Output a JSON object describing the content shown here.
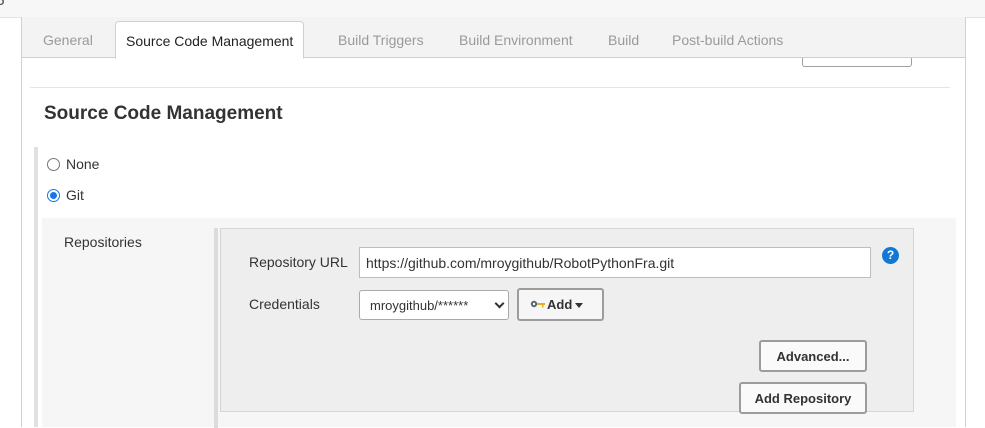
{
  "tabs": [
    {
      "label": "General",
      "active": false
    },
    {
      "label": "Source Code Management",
      "active": true
    },
    {
      "label": "Build Triggers",
      "active": false
    },
    {
      "label": "Build Environment",
      "active": false
    },
    {
      "label": "Build",
      "active": false
    },
    {
      "label": "Post-build Actions",
      "active": false
    }
  ],
  "section": {
    "title": "Source Code Management"
  },
  "scm_options": [
    {
      "label": "None",
      "checked": false
    },
    {
      "label": "Git",
      "checked": true
    }
  ],
  "repositories": {
    "label": "Repositories",
    "url_label": "Repository URL",
    "url_value": "https://github.com/mroygithub/RobotPythonFra.git",
    "credentials_label": "Credentials",
    "credentials_value": "mroygithub/******",
    "add_label": "Add",
    "advanced_label": "Advanced...",
    "add_repository_label": "Add Repository"
  },
  "help_icon": "?",
  "colors": {
    "accent": "#1378d4",
    "radio": "#1a73e8"
  }
}
